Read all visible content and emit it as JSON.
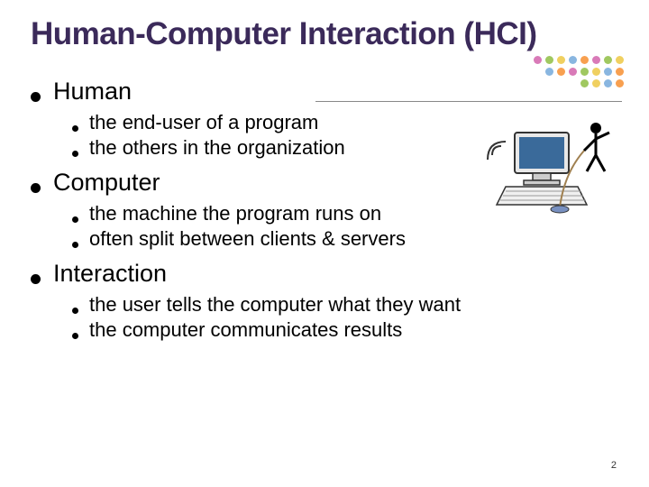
{
  "title": "Human-Computer Interaction (HCI)",
  "sections": [
    {
      "heading": "Human",
      "items": [
        "the end-user of a program",
        "the others in the organization"
      ]
    },
    {
      "heading": "Computer",
      "items": [
        "the machine the program runs on",
        "often split between clients & servers"
      ]
    },
    {
      "heading": "Interaction",
      "items": [
        "the user tells the computer what they want",
        "the computer communicates results"
      ]
    }
  ],
  "page_number": "2",
  "decor_colors": {
    "row1": [
      "#d97ab8",
      "#a0c860",
      "#f0d060",
      "#89b6e0",
      "#f8a050",
      "#d97ab8",
      "#a0c860",
      "#f0d060"
    ],
    "row2": [
      "#89b6e0",
      "#f8a050",
      "#d97ab8",
      "#a0c860",
      "#f0d060",
      "#89b6e0",
      "#f8a050"
    ],
    "row3": [
      "#a0c860",
      "#f0d060",
      "#89b6e0",
      "#f8a050"
    ]
  }
}
